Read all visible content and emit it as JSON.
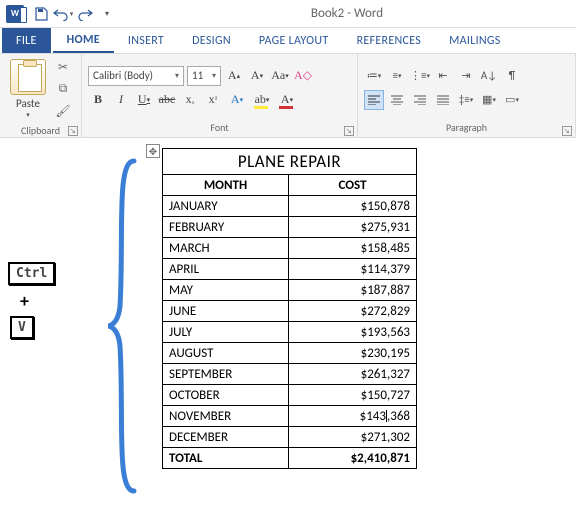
{
  "app": {
    "title": "Book2 - Word",
    "app_icon_text": "W"
  },
  "qat": {
    "save": "save-icon",
    "undo": "undo-icon",
    "redo": "redo-icon"
  },
  "tabs": {
    "file": "FILE",
    "items": [
      "HOME",
      "INSERT",
      "DESIGN",
      "PAGE LAYOUT",
      "REFERENCES",
      "MAILINGS"
    ],
    "active": "HOME"
  },
  "ribbon": {
    "clipboard": {
      "label": "Clipboard",
      "paste": "Paste"
    },
    "font": {
      "label": "Font",
      "name": "Calibri (Body)",
      "size": "11"
    },
    "paragraph": {
      "label": "Paragraph"
    }
  },
  "overlay": {
    "key1": "Ctrl",
    "plus": "+",
    "key2": "V"
  },
  "table": {
    "title": "PLANE REPAIR",
    "headers": [
      "MONTH",
      "COST"
    ],
    "rows": [
      {
        "month": "JANUARY",
        "cost": "$150,878"
      },
      {
        "month": "FEBRUARY",
        "cost": "$275,931"
      },
      {
        "month": "MARCH",
        "cost": "$158,485"
      },
      {
        "month": "APRIL",
        "cost": "$114,379"
      },
      {
        "month": "MAY",
        "cost": "$187,887"
      },
      {
        "month": "JUNE",
        "cost": "$272,829"
      },
      {
        "month": "JULY",
        "cost": "$193,563"
      },
      {
        "month": "AUGUST",
        "cost": "$230,195"
      },
      {
        "month": "SEPTEMBER",
        "cost": "$261,327"
      },
      {
        "month": "OCTOBER",
        "cost": "$150,727"
      },
      {
        "month": "NOVEMBER",
        "cost": "$143,368"
      },
      {
        "month": "DECEMBER",
        "cost": "$271,302"
      }
    ],
    "total": {
      "label": "TOTAL",
      "value": "$2,410,871"
    },
    "cursor_in_row": 10
  }
}
